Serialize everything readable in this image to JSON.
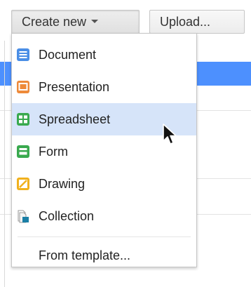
{
  "toolbar": {
    "create_label": "Create new",
    "upload_label": "Upload..."
  },
  "menu": {
    "items": [
      {
        "label": "Document",
        "icon": "document-icon",
        "color": "#4a8ee6"
      },
      {
        "label": "Presentation",
        "icon": "presentation-icon",
        "color": "#ee8a3a"
      },
      {
        "label": "Spreadsheet",
        "icon": "spreadsheet-icon",
        "color": "#39a94e",
        "highlighted": true
      },
      {
        "label": "Form",
        "icon": "form-icon",
        "color": "#39a94e"
      },
      {
        "label": "Drawing",
        "icon": "drawing-icon",
        "color": "#f1b11d"
      },
      {
        "label": "Collection",
        "icon": "collection-icon",
        "color": "#1b7fa6"
      }
    ],
    "template_label": "From template..."
  },
  "colors": {
    "highlight": "#d6e4f9",
    "selection_blue": "#4d90fe"
  }
}
